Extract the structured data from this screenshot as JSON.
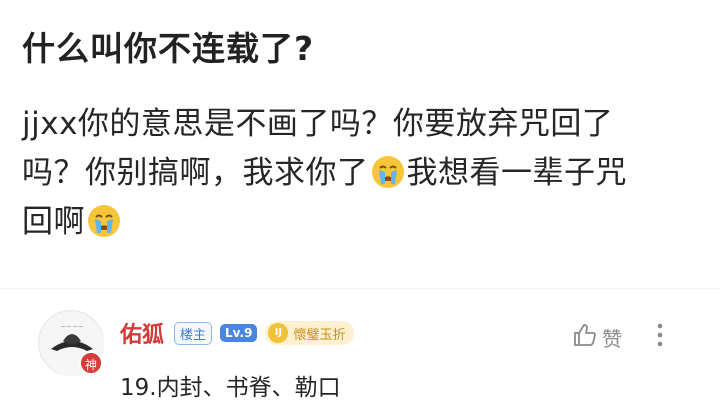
{
  "post": {
    "title": "什么叫你不连载了?",
    "body": {
      "line1": "jjxx你的意思是不画了吗？你要放弃咒回了",
      "line2_a": "吗？你别搞啊，我求你了",
      "line2_b": "我想看一辈子咒",
      "line3_a": "回啊"
    },
    "emoji_name": "crying-face-icon"
  },
  "reply": {
    "author": "佑狐",
    "avatar_badge": "神",
    "tag_owner": "楼主",
    "tag_level": "Lv.9",
    "medal_icon_text": "IJ",
    "medal_label": "懷璧玉折",
    "like_label": "赞",
    "text": "19.内封、书脊、勒口"
  },
  "colors": {
    "author_name": "#d23a3a",
    "level_badge": "#4a86dd",
    "medal_bg": "#fdf1cf"
  }
}
